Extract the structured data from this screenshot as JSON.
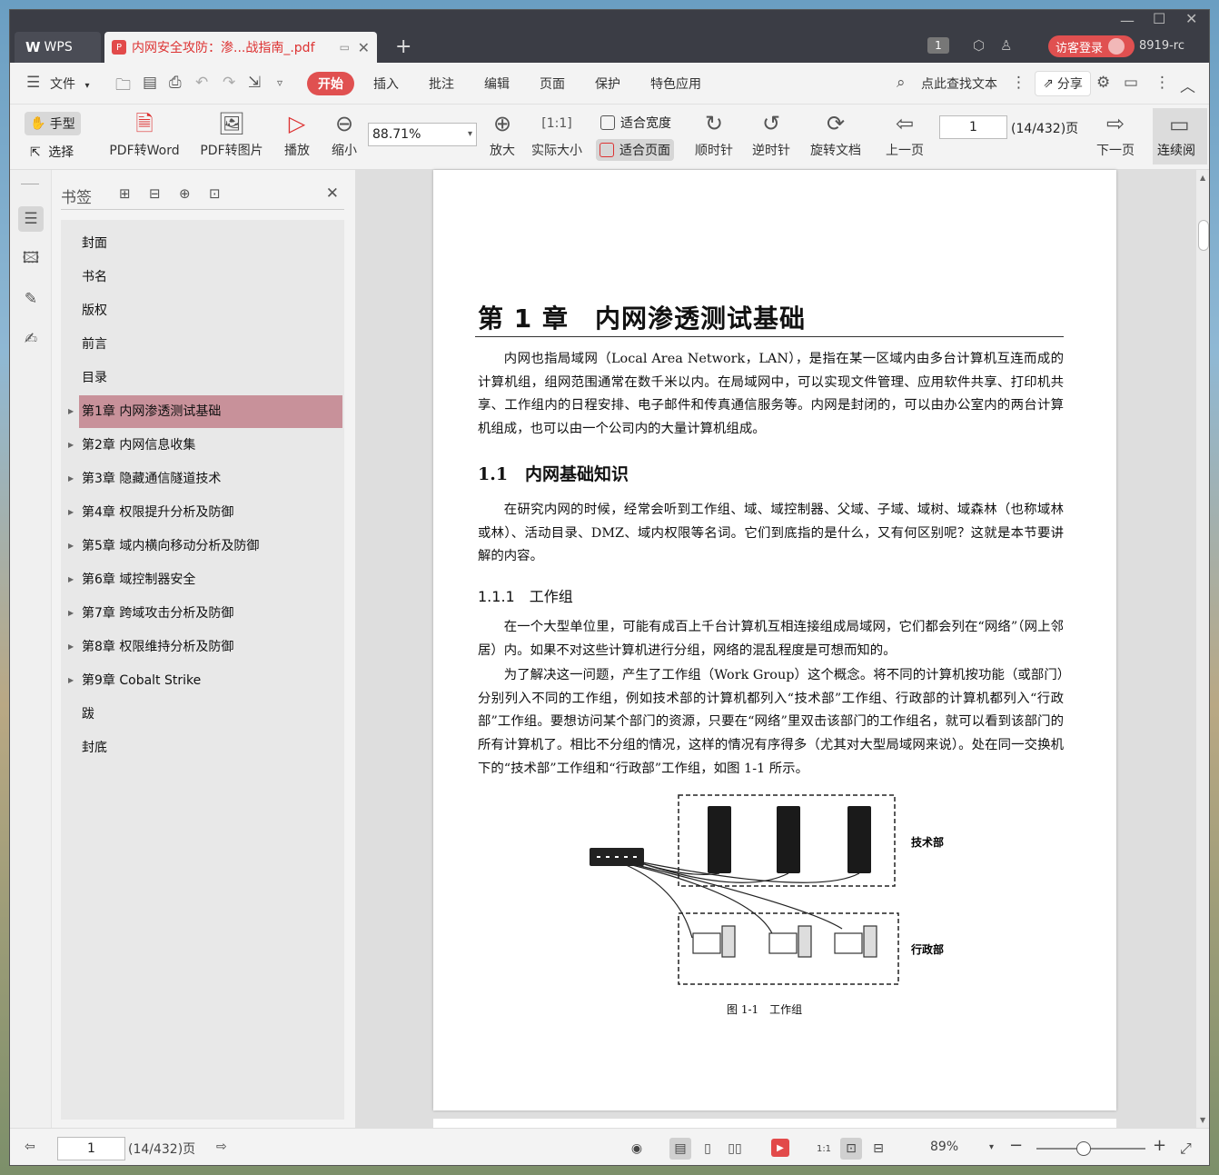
{
  "titlebar": {
    "wps_tab": "WPS",
    "doc_tab": "内网安全攻防：渗...战指南_.pdf",
    "badge_count": "1",
    "login": "访客登录",
    "version": "8919-rc"
  },
  "menu": {
    "file": "文件",
    "items": [
      "开始",
      "插入",
      "批注",
      "编辑",
      "页面",
      "保护",
      "特色应用"
    ],
    "search": "点此查找文本",
    "share": "分享"
  },
  "toolbar": {
    "hand": "手型",
    "select": "选择",
    "pdf_to_word": "PDF转Word",
    "pdf_to_image": "PDF转图片",
    "play": "播放",
    "zoom_out": "缩小",
    "zoom_value": "88.71%",
    "zoom_in": "放大",
    "actual_size": "实际大小",
    "fit_width": "适合宽度",
    "fit_page": "适合页面",
    "rotate_cw": "顺时针",
    "rotate_ccw": "逆时针",
    "rotate_doc": "旋转文档",
    "prev_page": "上一页",
    "page_number": "1",
    "page_total": "(14/432)页",
    "next_page": "下一页",
    "continuous": "连续阅"
  },
  "bookmarks": {
    "title": "书签",
    "items": [
      {
        "label": "封面",
        "expandable": false
      },
      {
        "label": "书名",
        "expandable": false
      },
      {
        "label": "版权",
        "expandable": false
      },
      {
        "label": "前言",
        "expandable": false
      },
      {
        "label": "目录",
        "expandable": false
      },
      {
        "label": "第1章 内网渗透测试基础",
        "expandable": true,
        "selected": true
      },
      {
        "label": "第2章 内网信息收集",
        "expandable": true
      },
      {
        "label": "第3章 隐藏通信隧道技术",
        "expandable": true
      },
      {
        "label": "第4章 权限提升分析及防御",
        "expandable": true
      },
      {
        "label": "第5章 域内横向移动分析及防御",
        "expandable": true
      },
      {
        "label": "第6章 域控制器安全",
        "expandable": true
      },
      {
        "label": "第7章 跨域攻击分析及防御",
        "expandable": true
      },
      {
        "label": "第8章 权限维持分析及防御",
        "expandable": true
      },
      {
        "label": "第9章 Cobalt Strike",
        "expandable": true
      },
      {
        "label": "跋",
        "expandable": false
      },
      {
        "label": "封底",
        "expandable": false
      }
    ]
  },
  "document": {
    "chapter_title": "第 1 章　内网渗透测试基础",
    "intro": "内网也指局域网（Local Area Network，LAN），是指在某一区域内由多台计算机互连而成的计算机组，组网范围通常在数千米以内。在局域网中，可以实现文件管理、应用软件共享、打印机共享、工作组内的日程安排、电子邮件和传真通信服务等。内网是封闭的，可以由办公室内的两台计算机组成，也可以由一个公司内的大量计算机组成。",
    "section_1_1": "1.1　内网基础知识",
    "section_1_1_text": "在研究内网的时候，经常会听到工作组、域、域控制器、父域、子域、域树、域森林（也称域林或林）、活动目录、DMZ、域内权限等名词。它们到底指的是什么，又有何区别呢？这就是本节要讲解的内容。",
    "section_1_1_1": "1.1.1　工作组",
    "para1": "在一个大型单位里，可能有成百上千台计算机互相连接组成局域网，它们都会列在“网络”（网上邻居）内。如果不对这些计算机进行分组，网络的混乱程度是可想而知的。",
    "para2": "为了解决这一问题，产生了工作组（Work Group）这个概念。将不同的计算机按功能（或部门）分别列入不同的工作组，例如技术部的计算机都列入“技术部”工作组、行政部的计算机都列入“行政部”工作组。要想访问某个部门的资源，只要在“网络”里双击该部门的工作组名，就可以看到该部门的所有计算机了。相比不分组的情况，这样的情况有序得多（尤其对大型局域网来说）。处在同一交换机下的“技术部”工作组和“行政部”工作组，如图 1-1 所示。",
    "figure_label_tech": "技术部",
    "figure_label_admin": "行政部",
    "figure_caption": "图 1-1　工作组"
  },
  "statusbar": {
    "page_number": "1",
    "page_total": "(14/432)页",
    "zoom": "89%"
  },
  "colors": {
    "accent": "#e05050",
    "selected_bookmark": "#c8919a",
    "titlebar": "#3b3d45"
  }
}
